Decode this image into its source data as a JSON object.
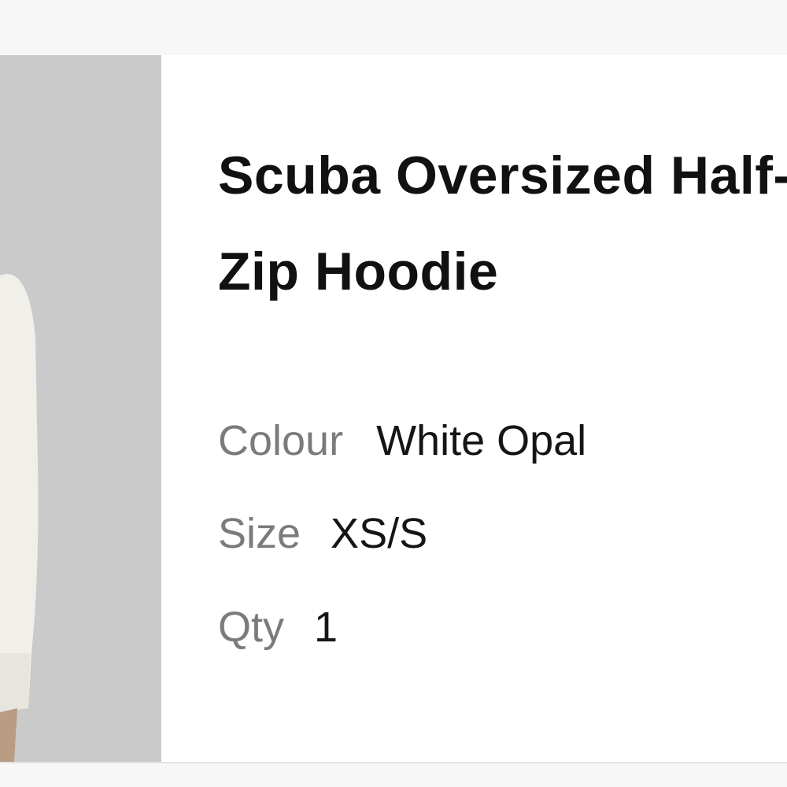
{
  "product": {
    "title": "Scuba Oversized Half-Zip Hoodie",
    "image_alt": "product-photo"
  },
  "attributes": {
    "colour": {
      "label": "Colour",
      "value": "White Opal"
    },
    "size": {
      "label": "Size",
      "value": "XS/S"
    },
    "qty": {
      "label": "Qty",
      "value": "1"
    }
  },
  "colors": {
    "image_background": "#c9cac9",
    "garment": "#f1efea",
    "label_text": "#7b7b7b",
    "value_text": "#151515"
  }
}
